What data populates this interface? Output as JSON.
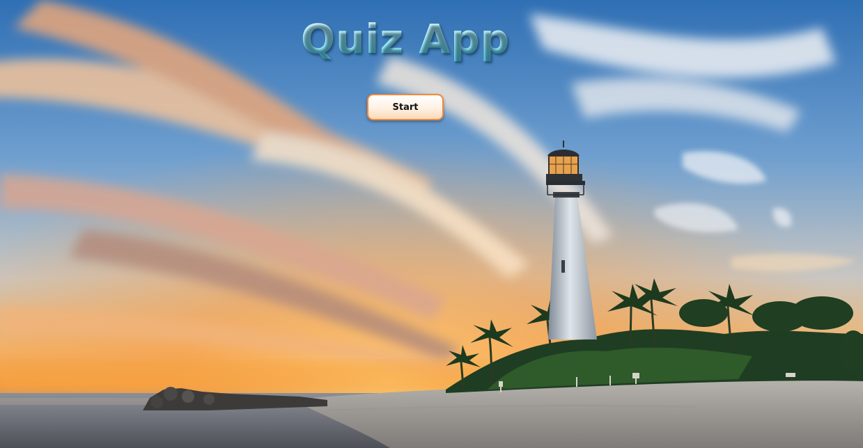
{
  "app": {
    "title": "Quiz App"
  },
  "actions": {
    "start_label": "Start"
  },
  "theme": {
    "title_color": "#a6f0fb",
    "button_border": "#f08a3a",
    "button_fill": "#fff1e3"
  },
  "background": {
    "icon": "lighthouse-sunset-photo"
  }
}
